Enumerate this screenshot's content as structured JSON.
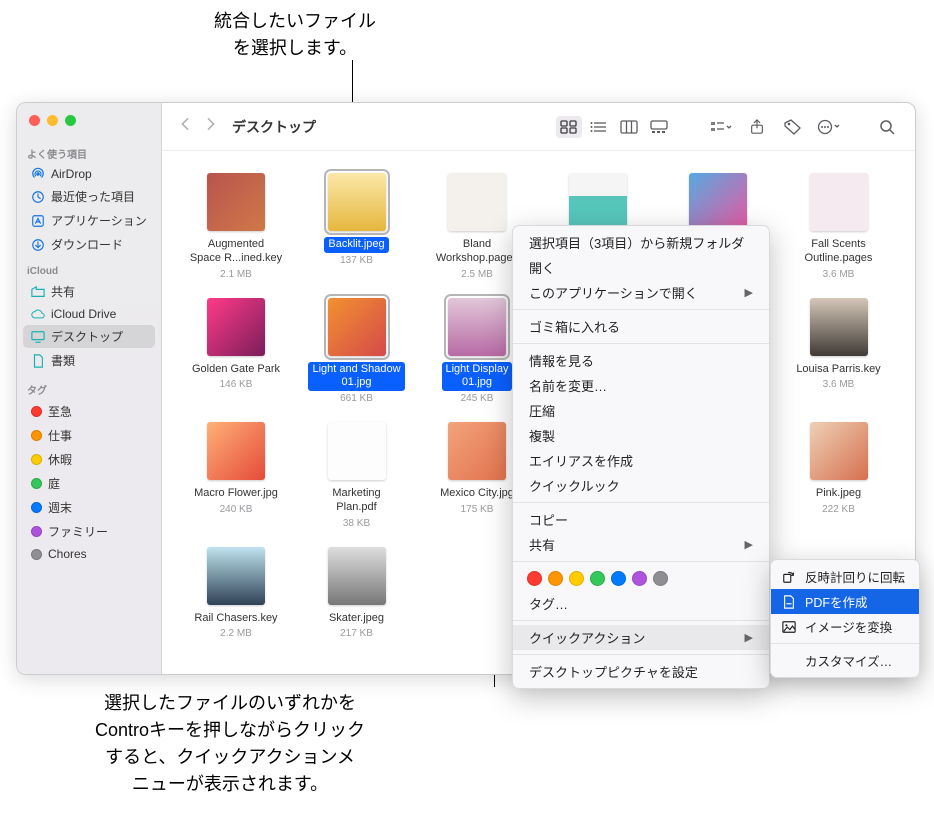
{
  "callouts": {
    "top": "統合したいファイル\nを選択します。",
    "bottom": "選択したファイルのいずれかを\nControキーを押しながらクリック\nすると、クイックアクションメ\nニューが表示されます。"
  },
  "window_title": "デスクトップ",
  "sidebar": {
    "favorites_heading": "よく使う項目",
    "favorites": [
      {
        "icon": "airdrop-icon",
        "label": "AirDrop"
      },
      {
        "icon": "clock-icon",
        "label": "最近使った項目"
      },
      {
        "icon": "app-icon",
        "label": "アプリケーション"
      },
      {
        "icon": "download-icon",
        "label": "ダウンロード"
      }
    ],
    "icloud_heading": "iCloud",
    "icloud": [
      {
        "icon": "shared-icon",
        "label": "共有"
      },
      {
        "icon": "icloud-icon",
        "label": "iCloud Drive"
      },
      {
        "icon": "desktop-icon",
        "label": "デスクトップ",
        "selected": true
      },
      {
        "icon": "documents-icon",
        "label": "書類"
      }
    ],
    "tags_heading": "タグ",
    "tags": [
      {
        "color": "#ff3b30",
        "label": "至急"
      },
      {
        "color": "#ff9500",
        "label": "仕事"
      },
      {
        "color": "#ffcc00",
        "label": "休暇"
      },
      {
        "color": "#34c759",
        "label": "庭"
      },
      {
        "color": "#007aff",
        "label": "週末"
      },
      {
        "color": "#af52de",
        "label": "ファミリー"
      },
      {
        "color": "#8e8e93",
        "label": "Chores"
      }
    ]
  },
  "files": [
    {
      "name": "Augmented\nSpace R...ined.key",
      "size": "2.1 MB",
      "th": "th-a"
    },
    {
      "name": "Backlit.jpeg",
      "size": "137 KB",
      "th": "th-b",
      "selected": true
    },
    {
      "name": "Bland\nWorkshop.pages",
      "size": "2.5 MB",
      "th": "th-c"
    },
    {
      "name": "",
      "size": "",
      "th": "th-d"
    },
    {
      "name": "",
      "size": "",
      "th": "th-e"
    },
    {
      "name": "Fall Scents\nOutline.pages",
      "size": "3.6 MB",
      "th": "th-f"
    },
    {
      "name": "Golden Gate Park",
      "size": "146 KB",
      "th": "th-g"
    },
    {
      "name": "Light and Shadow\n01.jpg",
      "size": "661 KB",
      "th": "th-h",
      "selected": true
    },
    {
      "name": "Light Display\n01.jpg",
      "size": "245 KB",
      "th": "th-i",
      "selected": true
    },
    {
      "name": "",
      "size": "",
      "th": ""
    },
    {
      "name": "",
      "size": "",
      "th": ""
    },
    {
      "name": "Louisa Parris.key",
      "size": "3.6 MB",
      "th": "th-j"
    },
    {
      "name": "Macro Flower.jpg",
      "size": "240 KB",
      "th": "th-k"
    },
    {
      "name": "Marketing\nPlan.pdf",
      "size": "38 KB",
      "th": "th-l"
    },
    {
      "name": "Mexico City.jpg",
      "size": "175 KB",
      "th": "th-m"
    },
    {
      "name": "",
      "size": "",
      "th": ""
    },
    {
      "name": "",
      "size": "",
      "th": ""
    },
    {
      "name": "Pink.jpeg",
      "size": "222 KB",
      "th": "th-n"
    },
    {
      "name": "Rail Chasers.key",
      "size": "2.2 MB",
      "th": "th-o"
    },
    {
      "name": "Skater.jpeg",
      "size": "217 KB",
      "th": "th-p"
    }
  ],
  "context_menu": {
    "items": [
      {
        "label": "選択項目（3項目）から新規フォルダ"
      },
      {
        "label": "開く"
      },
      {
        "label": "このアプリケーションで開く",
        "submenu": true
      },
      {
        "sep": true
      },
      {
        "label": "ゴミ箱に入れる"
      },
      {
        "sep": true
      },
      {
        "label": "情報を見る"
      },
      {
        "label": "名前を変更…"
      },
      {
        "label": "圧縮"
      },
      {
        "label": "複製"
      },
      {
        "label": "エイリアスを作成"
      },
      {
        "label": "クイックルック"
      },
      {
        "sep": true
      },
      {
        "label": "コピー"
      },
      {
        "label": "共有",
        "submenu": true
      },
      {
        "sep": true
      },
      {
        "tags": true
      },
      {
        "label": "タグ…"
      },
      {
        "sep": true
      },
      {
        "label": "クイックアクション",
        "submenu": true,
        "highlighted": true
      },
      {
        "sep": true
      },
      {
        "label": "デスクトップピクチャを設定"
      }
    ],
    "tag_colors": [
      "#ff3b30",
      "#ff9500",
      "#ffcc00",
      "#34c759",
      "#007aff",
      "#af52de",
      "#8e8e93"
    ]
  },
  "submenu": {
    "items": [
      {
        "icon": "rotate-icon",
        "label": "反時計回りに回転"
      },
      {
        "icon": "pdf-icon",
        "label": "PDFを作成",
        "highlighted": true
      },
      {
        "icon": "image-icon",
        "label": "イメージを変換"
      },
      {
        "sep": true
      },
      {
        "label": "カスタマイズ…"
      }
    ]
  }
}
